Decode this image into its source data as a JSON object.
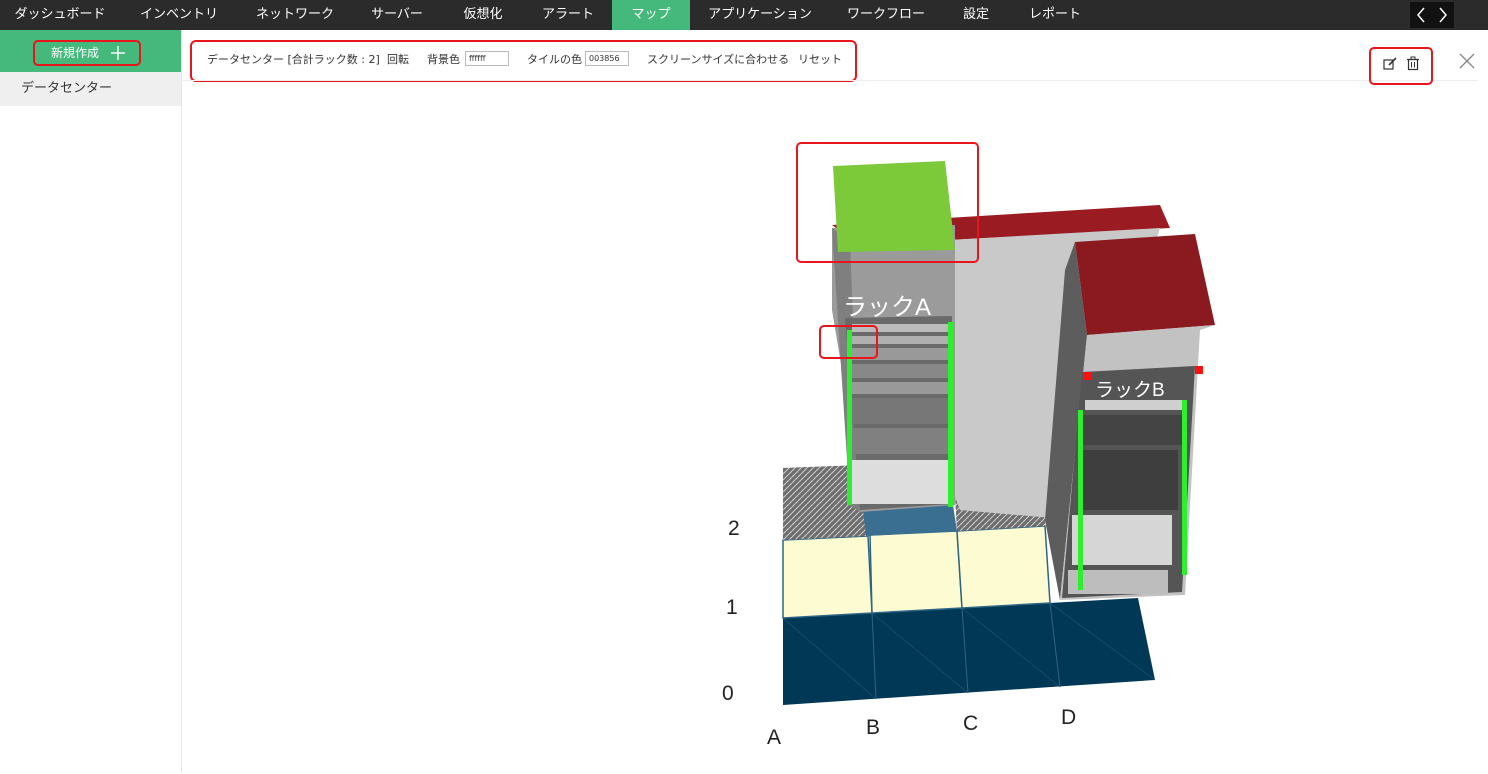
{
  "nav": {
    "items": [
      {
        "label": "ダッシュボード",
        "active": false
      },
      {
        "label": "インベントリ",
        "active": false
      },
      {
        "label": "ネットワーク",
        "active": false
      },
      {
        "label": "サーバー",
        "active": false
      },
      {
        "label": "仮想化",
        "active": false
      },
      {
        "label": "アラート",
        "active": false
      },
      {
        "label": "マップ",
        "active": true
      },
      {
        "label": "アプリケーション",
        "active": false
      },
      {
        "label": "ワークフロー",
        "active": false
      },
      {
        "label": "設定",
        "active": false
      },
      {
        "label": "レポート",
        "active": false
      }
    ],
    "prev_icon": "chevron-left-icon",
    "next_icon": "chevron-right-icon"
  },
  "sidebar": {
    "new_label": "新規作成",
    "new_icon": "plus-icon",
    "items": [
      {
        "label": "データセンター"
      }
    ]
  },
  "toolbar": {
    "title": "データセンター [合計ラック数 : 2]",
    "rotate_label": "回転",
    "bg_label": "背景色",
    "bg_value": "ffffff",
    "tile_label": "タイルの色",
    "tile_value": "003856",
    "fit_label": "スクリーンサイズに合わせる",
    "reset_label": "リセット"
  },
  "actions": {
    "edit_icon": "edit-icon",
    "delete_icon": "trash-icon",
    "close_icon": "close-icon"
  },
  "map": {
    "racks": [
      {
        "label": "ラックA",
        "status_color": "#7cc93a"
      },
      {
        "label": "ラックB",
        "status_color": "#8a1a1f"
      }
    ],
    "row_labels": [
      "2",
      "1",
      "0"
    ],
    "col_labels": [
      "A",
      "B",
      "C",
      "D"
    ],
    "tile_color": "#003856",
    "selected_tile_color": "#fdfbd2"
  },
  "colors": {
    "accent": "#45b97c",
    "nav_bg": "#2b2b2b",
    "highlight": "#e8151b"
  }
}
